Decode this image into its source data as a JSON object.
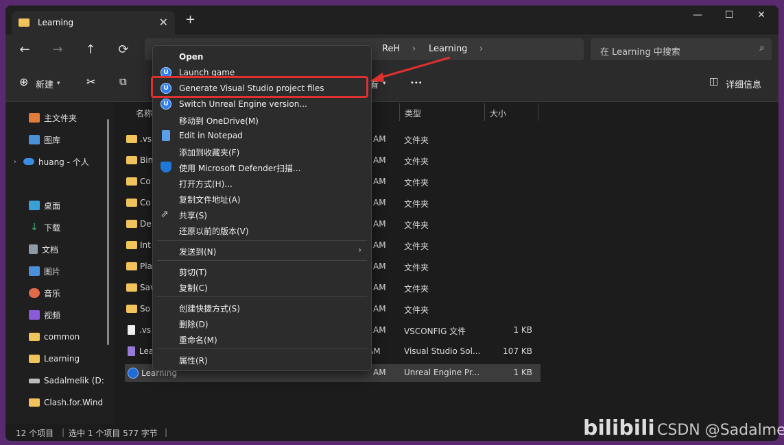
{
  "tab": {
    "title": "Learning"
  },
  "window": {
    "minimize": "—",
    "maximize": "☐",
    "close": "✕"
  },
  "nav": {
    "back": "←",
    "forward": "→",
    "up": "↑",
    "refresh": "⟳",
    "breadcrumbs": [
      "ReH",
      "Learning"
    ],
    "search_placeholder": "在 Learning 中搜索"
  },
  "toolbar": {
    "new_label": "新建",
    "view_label": "看",
    "more": "•••",
    "details_label": "详细信息"
  },
  "sidebar": {
    "items": [
      {
        "label": "主文件夹"
      },
      {
        "label": "图库"
      },
      {
        "label": "huang - 个人"
      },
      {
        "label": "桌面",
        "pinned": true
      },
      {
        "label": "下载",
        "pinned": true
      },
      {
        "label": "文档",
        "pinned": true
      },
      {
        "label": "图片",
        "pinned": true
      },
      {
        "label": "音乐",
        "pinned": true
      },
      {
        "label": "视频",
        "pinned": true
      },
      {
        "label": "common"
      },
      {
        "label": "Learning"
      },
      {
        "label": "Sadalmelik (D:"
      },
      {
        "label": "Clash.for.Wind"
      }
    ]
  },
  "columns": {
    "name": "名称",
    "type": "类型",
    "size": "大小"
  },
  "files": [
    {
      "name": ".vs",
      "time": "AM",
      "type": "文件夹",
      "size": ""
    },
    {
      "name": "Bin",
      "time": "AM",
      "type": "文件夹",
      "size": ""
    },
    {
      "name": "Co",
      "time": "AM",
      "type": "文件夹",
      "size": ""
    },
    {
      "name": "Co",
      "time": "AM",
      "type": "文件夹",
      "size": ""
    },
    {
      "name": "De",
      "time": "AM",
      "type": "文件夹",
      "size": ""
    },
    {
      "name": "Int",
      "time": "AM",
      "type": "文件夹",
      "size": ""
    },
    {
      "name": "Pla",
      "time": "AM",
      "type": "文件夹",
      "size": ""
    },
    {
      "name": "Sav",
      "time": "AM",
      "type": "文件夹",
      "size": ""
    },
    {
      "name": "So",
      "time": "AM",
      "type": "文件夹",
      "size": ""
    },
    {
      "name": ".vs",
      "time": "AM",
      "type": "VSCONFIG 文件",
      "size": "1 KB"
    },
    {
      "name": "Lea",
      "time": "AM",
      "type": "Visual Studio Sol...",
      "size": "107 KB"
    },
    {
      "name": "Learning",
      "time": "AM",
      "type": "Unreal Engine Pr...",
      "size": "1 KB"
    }
  ],
  "status": {
    "count": "12 个项目",
    "selected": "选中 1 个项目  577 字节"
  },
  "context_menu": {
    "items": [
      "Open",
      "Launch game",
      "Generate Visual Studio project files",
      "Switch Unreal Engine version...",
      "移动到 OneDrive(M)",
      "Edit in Notepad",
      "添加到收藏夹(F)",
      "使用 Microsoft Defender扫描...",
      "打开方式(H)...",
      "复制文件地址(A)",
      "共享(S)",
      "还原以前的版本(V)",
      "发送到(N)",
      "剪切(T)",
      "复制(C)",
      "创建快捷方式(S)",
      "删除(D)",
      "重命名(M)",
      "属性(R)"
    ]
  },
  "watermark": {
    "logo": "bilibili",
    "text": "CSDN @Sadalmelik"
  },
  "colors": {
    "highlight": "#e03030",
    "folder": "#f3c35b",
    "ue": "#2f7ef0"
  }
}
